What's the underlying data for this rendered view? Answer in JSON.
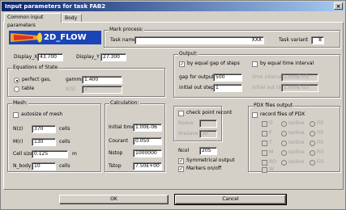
{
  "window": {
    "title": "Input parameters for task FAB2",
    "close_glyph": "×"
  },
  "tabs": [
    {
      "label": "Common input parameters"
    },
    {
      "label": "Body"
    }
  ],
  "logo": {
    "text": "2D_FLOW"
  },
  "mark_process": {
    "title": "Mark process:",
    "task_name_label": "Task name",
    "task_name_value": "XXX",
    "task_variant_label": "Task variant",
    "task_variant_value": "8"
  },
  "display": {
    "x_label": "Display_X",
    "x_value": "43.700",
    "y_label": "Display_Y",
    "y_value": "27.300"
  },
  "equations": {
    "title": "Equations of State",
    "perfect_gas_label": "perfect gas,",
    "table_label": "table",
    "gamma_label": "gamma",
    "gamma_value": "1.400",
    "ks_label": "K(S)",
    "ks_value": "3"
  },
  "output": {
    "title": "Output:",
    "by_gap_label": "by equal gap of steps",
    "by_time_label": "by equal time interval",
    "gap_label": "gap for output",
    "gap_value": "500",
    "initial_step_label": "initial out step",
    "initial_step_value": "1",
    "time_interval_label": "time interval",
    "time_interval_value": "1.000E-03",
    "initial_time_label": "initial out time",
    "initial_time_value": "1.000E-03"
  },
  "mesh": {
    "title": "Mesh:",
    "autosize_label": "autosize of mesh",
    "nz_label": "N(z)",
    "nz_value": "370",
    "nz_unit": "cells",
    "mr_label": "M(r)",
    "mr_value": "130",
    "mr_unit": "cells",
    "cell_size_label": "Cell size",
    "cell_size_value": "0.125",
    "cell_size_unit": "m",
    "nbody_label": "N_body",
    "nbody_value": "10",
    "nbody_unit": "cells"
  },
  "calculation": {
    "title": "Calculation:",
    "initial_time_label": "Initial time step",
    "initial_time_value": "1.00E-06",
    "courant_label": "Courant",
    "courant_value": "0.050",
    "nstop_label": "Nstop",
    "nstop_value": "1000000",
    "tstop_label": "Tstop",
    "tstop_value": "7.50E+00"
  },
  "checkpoint": {
    "label": "check point record",
    "nsave_label": "Nsave",
    "nsave_value": "",
    "nresave_label": "Nresave",
    "nresave_value": "30"
  },
  "ncol": {
    "label": "Ncol",
    "value": "205"
  },
  "symmetrical_label": "Symmetrical output",
  "markers_label": "Markers on/off",
  "pdx": {
    "title": "PDX files output",
    "record_label": "record files of PDX",
    "rows": [
      {
        "letter": "D",
        "isoline": "Isoline",
        "fill": "Fill"
      },
      {
        "letter": "P",
        "isoline": "Isoline",
        "fill": "Fill"
      },
      {
        "letter": "T",
        "isoline": "Isoline",
        "fill": "Fill"
      },
      {
        "letter": "M",
        "isoline": "Isoline",
        "fill": "Fill"
      },
      {
        "letter": "RO",
        "isoline": "Isoline",
        "fill": "Fill"
      }
    ],
    "w_label": "W"
  },
  "buttons": {
    "ok": "OK",
    "cancel": "Cancel"
  },
  "colors": {
    "title_start": "#0a246a",
    "title_end": "#a6caf0",
    "logo_bg": "#1a45b8"
  }
}
